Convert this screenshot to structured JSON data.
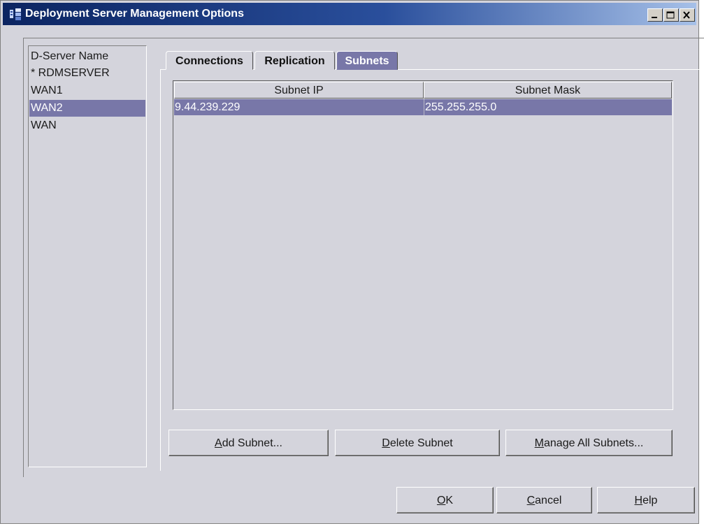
{
  "window": {
    "title": "Deployment Server Management Options",
    "colors": {
      "titlebar": "#0b2461",
      "selection": "#7877a8",
      "background": "#d4d4dc"
    }
  },
  "window_controls": [
    "minimize-icon",
    "maximize-icon",
    "close-icon"
  ],
  "server_list": {
    "items": [
      {
        "label": "D-Server Name",
        "selected": false
      },
      {
        "label": "* RDMSERVER",
        "selected": false
      },
      {
        "label": "WAN1",
        "selected": false
      },
      {
        "label": "WAN2",
        "selected": true
      },
      {
        "label": "WAN",
        "selected": false
      }
    ]
  },
  "tabs": [
    {
      "label": "Connections",
      "active": false
    },
    {
      "label": "Replication",
      "active": false
    },
    {
      "label": "Subnets",
      "active": true
    }
  ],
  "subnet_table": {
    "columns": [
      "Subnet IP",
      "Subnet Mask"
    ],
    "rows": [
      {
        "ip": "9.44.239.229",
        "mask": "255.255.255.0",
        "selected": true
      }
    ]
  },
  "subnet_buttons": {
    "add": {
      "mnemonic": "A",
      "rest": "dd Subnet..."
    },
    "delete": {
      "mnemonic": "D",
      "rest": "elete Subnet"
    },
    "manage": {
      "pre": "",
      "mnemonic": "M",
      "rest": "anage All Subnets..."
    }
  },
  "dialog_buttons": {
    "ok": {
      "mnemonic": "O",
      "rest": "K"
    },
    "cancel": {
      "mnemonic": "C",
      "rest": "ancel"
    },
    "help": {
      "mnemonic": "H",
      "rest": "elp"
    }
  }
}
